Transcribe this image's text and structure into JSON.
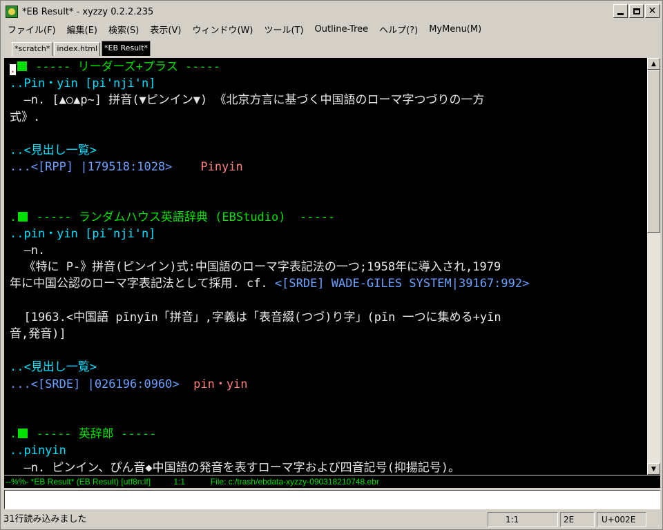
{
  "window": {
    "title": "*EB Result* - xyzzy 0.2.2.235",
    "min_label": "",
    "max_label": "",
    "close_label": "✕"
  },
  "menu": [
    "ファイル(F)",
    "編集(E)",
    "検索(S)",
    "表示(V)",
    "ウィンドウ(W)",
    "ツール(T)",
    "Outline-Tree",
    "ヘルプ(?)",
    "MyMenu(M)"
  ],
  "tabs": [
    "*scratch*",
    "index.html",
    "*EB Result*"
  ],
  "editor": {
    "l1_dash1": " ----- ",
    "l1_title": "リーダーズ+プラス",
    "l1_dash2": " -----",
    "l2": "..Pin・yin [pi'nji'n]",
    "l3": "  ―n. [▲○▲p~] 拼音(▼ピンイン▼) 《北京方言に基づく中国語のローマ字つづりの一方",
    "l4": "式》.",
    "l5": "",
    "l6": "..<見出し一覧>",
    "l7_link": "...<[RPP] |179518:1028>",
    "l7_word": "    Pinyin",
    "l10_dash1": " ----- ",
    "l10_title": "ランダムハウス英語辞典 (EBStudio)",
    "l10_dash2": "  -----",
    "l11": "..pin・yin [pi˜nji'n]",
    "l12": "  ―n.",
    "l13": "  《特に P-》拼音(ピンイン)式:中国語のローマ字表記法の一つ;1958年に導入され,1979",
    "l14_text": "年に中国公認のローマ字表記法として採用. cf. ",
    "l14_link": "<[SRDE] WADE-GILES SYSTEM|39167:992>",
    "l16": "  [1963.<中国語 pīnyīn「拼音」,字義は「表音綴(つづ)り字」(pīn 一つに集める+yīn",
    "l17": "音,発音)]",
    "l19": "..<見出し一覧>",
    "l20_link": "...<[SRDE] |026196:0960>",
    "l20_word": "  pin・yin",
    "l23_dash1": " ----- ",
    "l23_title": "英辞郎",
    "l23_dash2": " -----",
    "l24": "..pinyin",
    "l25": "  ―n. ピンイン、ぴん音◆中国語の発音を表すローマ字および四音記号(抑揚記号)。"
  },
  "modeline": "--%%- *EB Result* (EB Result) [utf8n:lf]          1:1           File: c:/trash/ebdata-xyzzy-090318210748.ebr",
  "status": {
    "message": "31行読み込みました",
    "position": "1:1",
    "code": "2E",
    "unicode": "U+002E"
  },
  "scrollbar": {
    "up": "▲",
    "down": "▼"
  },
  "colors": {
    "heading": "#00e000",
    "entry": "#00e0ff",
    "link": "#6aa0ff",
    "word": "#ff8080",
    "text": "#e8e8e8",
    "background": "#000000"
  }
}
